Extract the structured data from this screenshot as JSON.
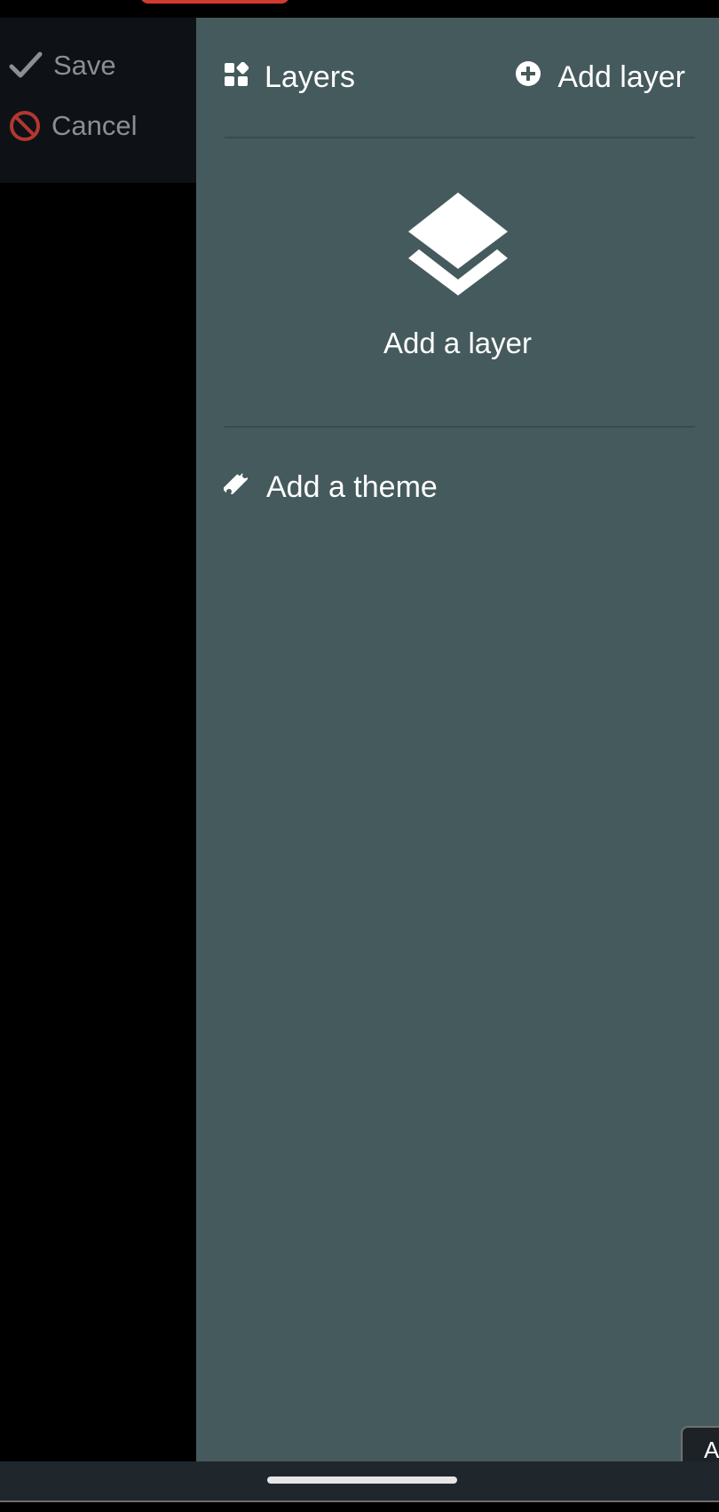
{
  "toolbar": {
    "save_label": "Save",
    "cancel_label": "Cancel"
  },
  "panel": {
    "title": "Layers",
    "add_layer_label": "Add layer",
    "empty_state_label": "Add a layer",
    "add_theme_label": "Add a theme"
  },
  "corner_button": {
    "label": "A"
  },
  "icons": {
    "save": "check-icon",
    "cancel": "cancel-icon",
    "layers": "layers-grid-icon",
    "add_layer": "plus-circle-icon",
    "empty_state": "stacked-layers-icon",
    "theme": "palette-brush-icon"
  },
  "colors": {
    "panel_bg": "#455a5d",
    "toolbar_bg": "#0e1217",
    "toolbar_text": "#8a8f94",
    "cancel_icon": "#b4372f",
    "accent_red": "#d23a2f"
  }
}
